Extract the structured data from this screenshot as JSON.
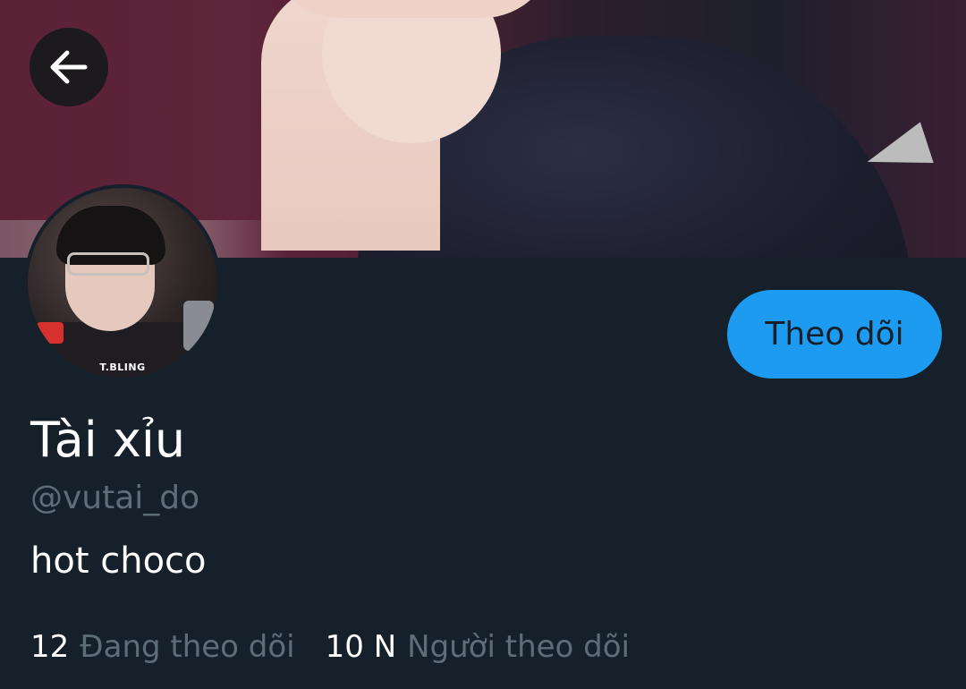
{
  "header": {
    "back_icon": "arrow-left-icon"
  },
  "profile": {
    "avatar_tag": "T.BLING",
    "display_name": "Tài xỉu",
    "handle": "@vutai_do",
    "bio": "hot choco",
    "follow_label": "Theo dõi"
  },
  "stats": {
    "following_count": "12",
    "following_label": "Đang theo dõi",
    "followers_count": "10 N",
    "followers_label": "Người theo dõi"
  },
  "colors": {
    "background": "#15202b",
    "accent": "#1d9bf0",
    "muted_text": "#5f6d79"
  }
}
